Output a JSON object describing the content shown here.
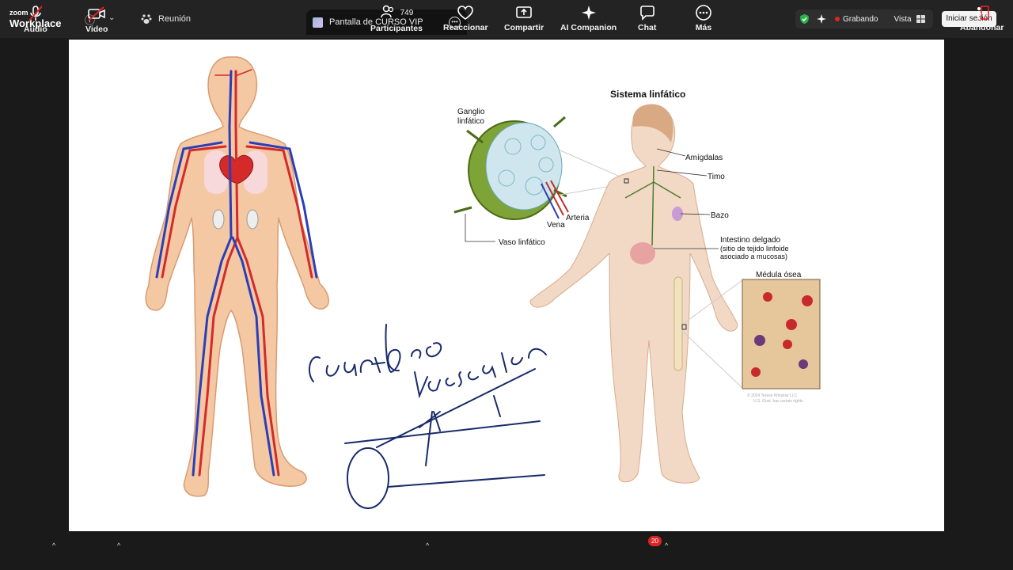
{
  "app": {
    "logo_small": "zoom",
    "logo_big": "Workplace"
  },
  "header": {
    "meeting_label": "Reunión",
    "share_tab_title": "Pantalla de CURSO VIP",
    "recording_label": "Grabando",
    "view_label": "Vista",
    "signin_label": "Iniciar sesión"
  },
  "slide": {
    "title": "Sistema linfático",
    "labels": {
      "node": "Ganglio",
      "node2": "linfático",
      "tonsils": "Amígdalas",
      "thymus": "Timo",
      "artery": "Arteria",
      "vein": "Vena",
      "spleen": "Bazo",
      "vessel": "Vaso linfático",
      "intestine": "Intestino delgado",
      "intestine2": "(sitio de tejido linfoide",
      "intestine3": "asociado a mucosas)",
      "marrow": "Médula ósea",
      "copyright": "© 2024 Terese Winslow LLC",
      "copyright2": "U.S. Govt. has certain rights"
    }
  },
  "toolbar": {
    "audio": "Audio",
    "video": "Video",
    "participants": "Participantes",
    "participants_count": "749",
    "react": "Reaccionar",
    "share": "Compartir",
    "ai": "AI Companion",
    "chat": "Chat",
    "chat_badge": "20",
    "more": "Más",
    "leave": "Abandonar"
  },
  "colors": {
    "recording": "#e02424",
    "shield": "#2bb24c"
  }
}
